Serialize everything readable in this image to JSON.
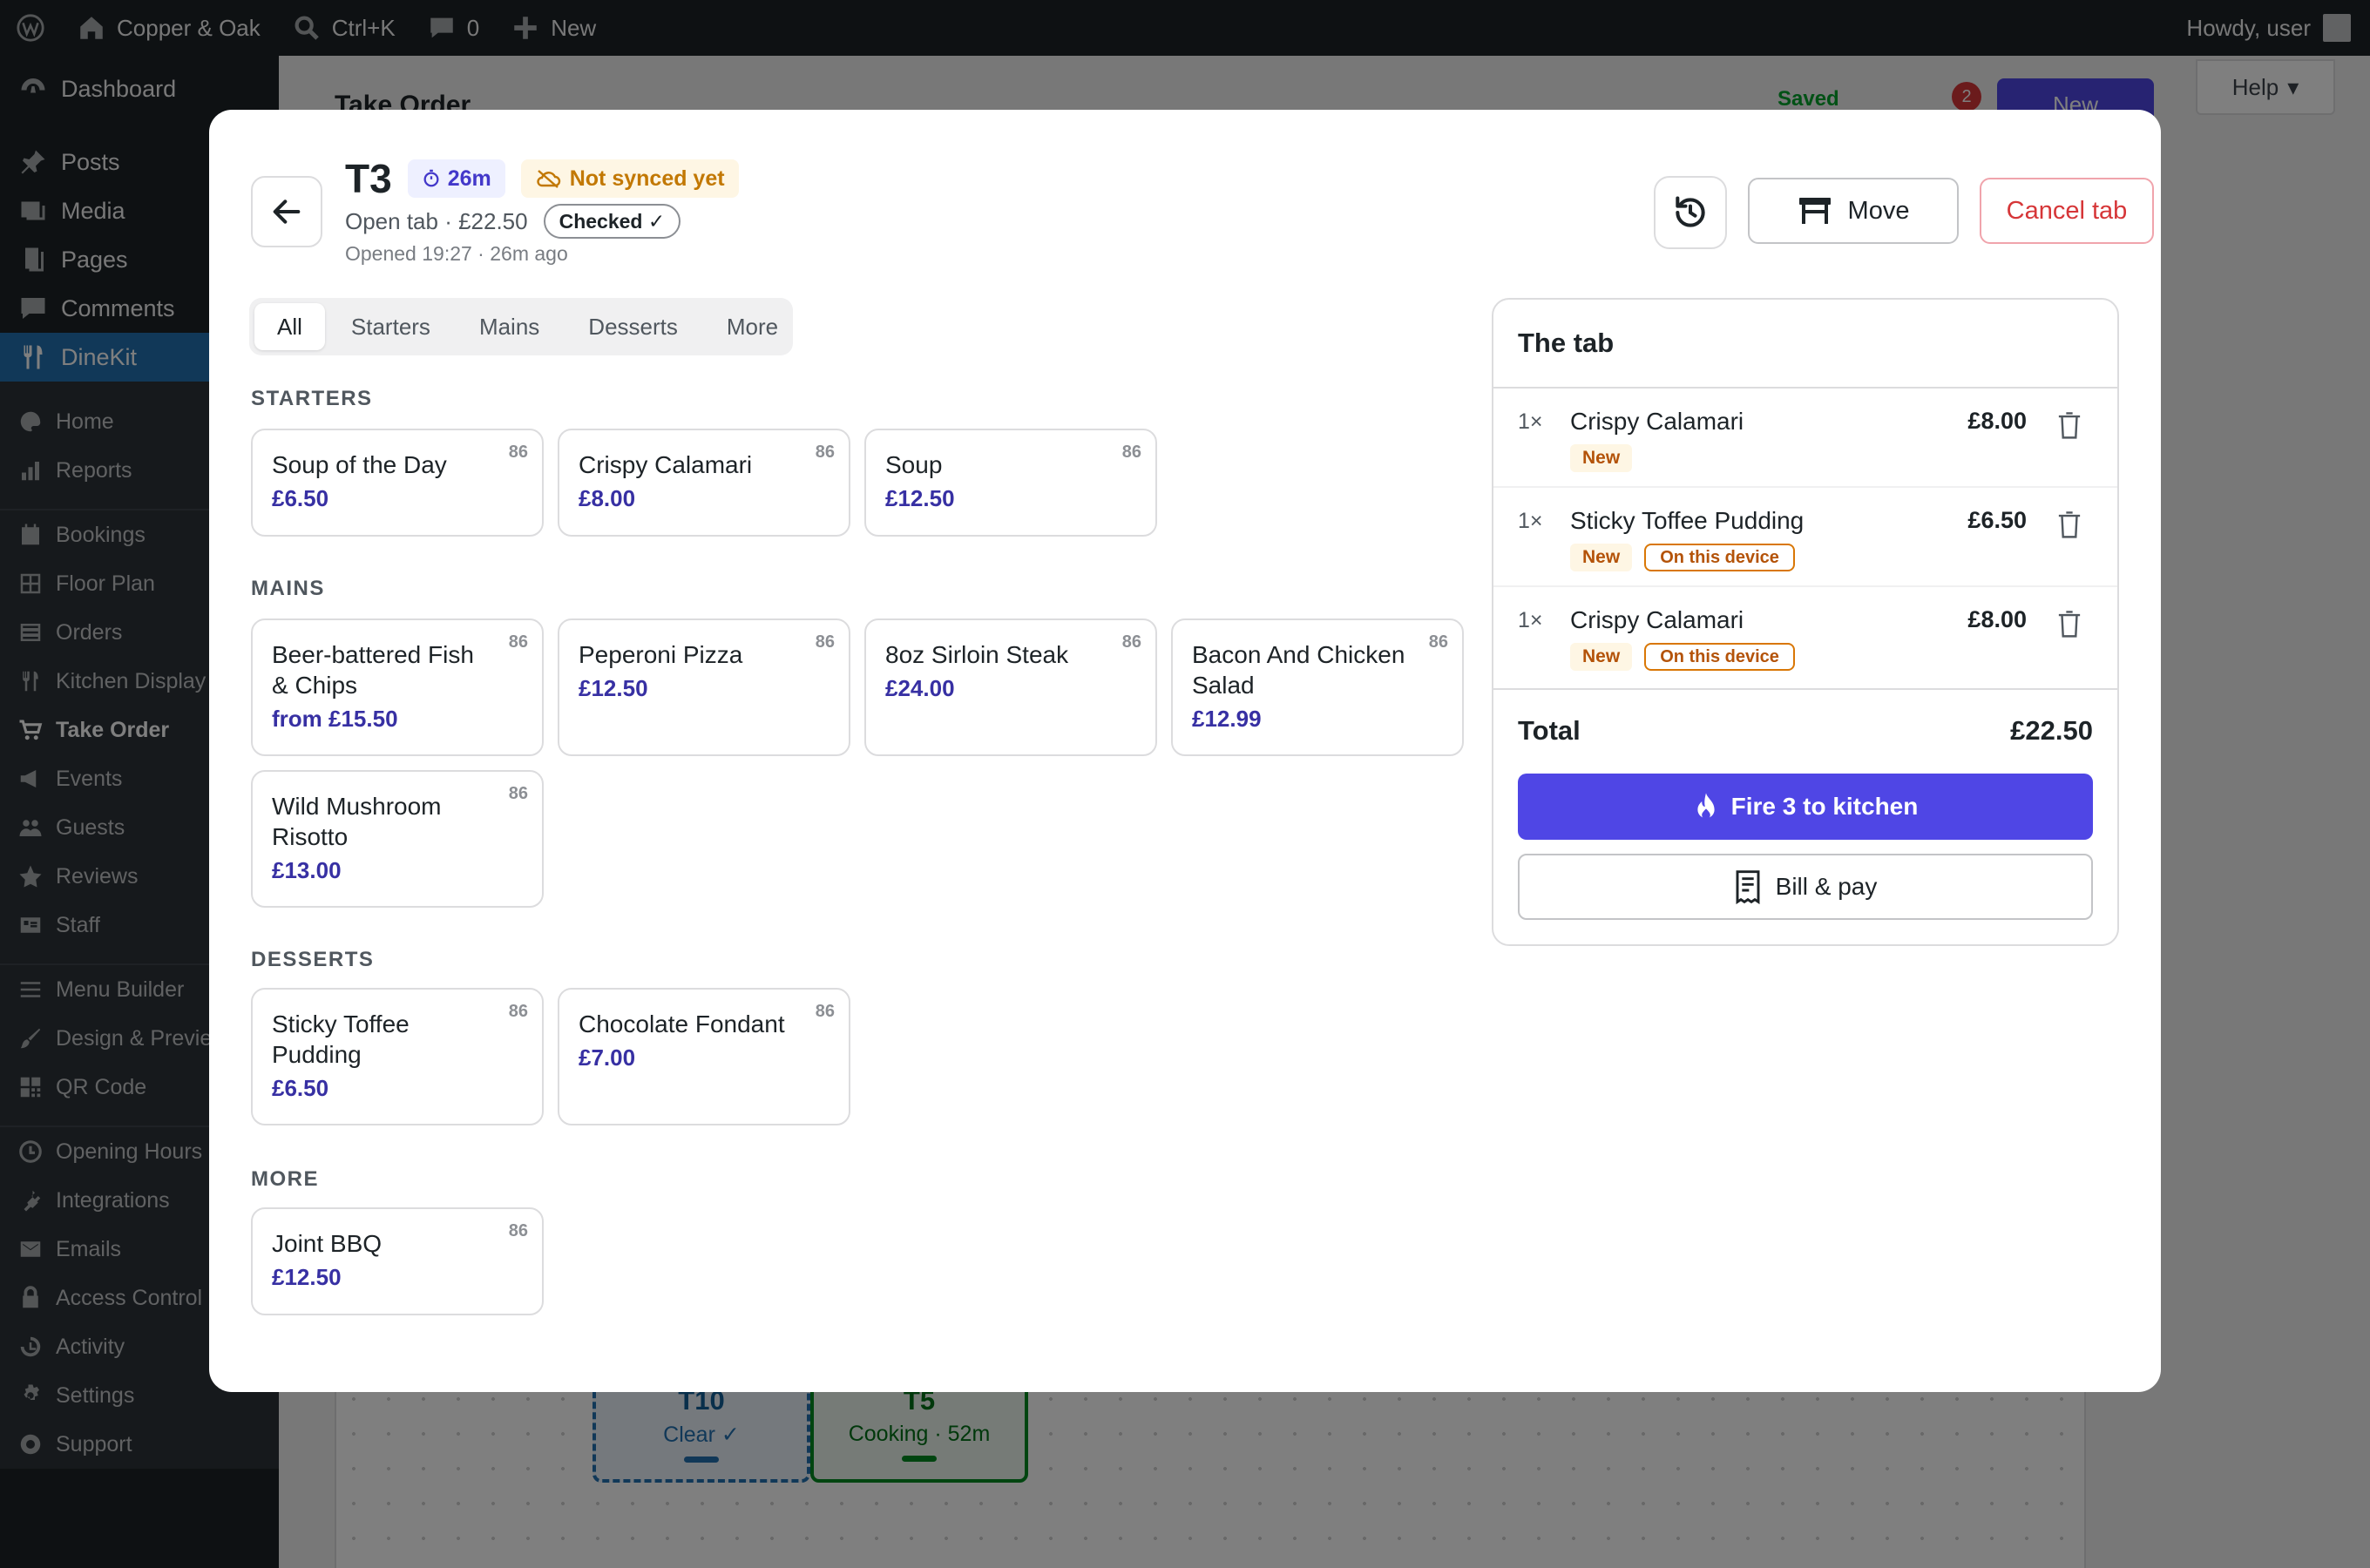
{
  "adminbar": {
    "site_name": "Copper & Oak",
    "search_shortcut": "Ctrl+K",
    "comments_count": "0",
    "new_label": "New",
    "howdy": "Howdy, user"
  },
  "sidebar": {
    "dashboard": "Dashboard",
    "posts": "Posts",
    "media": "Media",
    "pages": "Pages",
    "comments": "Comments",
    "dinekit": "DineKit",
    "sub": {
      "home": "Home",
      "reports": "Reports",
      "bookings": "Bookings",
      "floor_plan": "Floor Plan",
      "orders": "Orders",
      "kitchen_display": "Kitchen Display",
      "take_order": "Take Order",
      "events": "Events",
      "guests": "Guests",
      "reviews": "Reviews",
      "staff": "Staff",
      "menu_builder": "Menu Builder",
      "design_preview": "Design & Preview",
      "qr_code": "QR Code",
      "opening_hours": "Opening Hours",
      "integrations": "Integrations",
      "emails": "Emails",
      "access_control": "Access Control",
      "activity": "Activity",
      "settings": "Settings",
      "support": "Support"
    }
  },
  "background": {
    "page_title": "Take Order",
    "help_label": "Help",
    "saved_label": "Saved",
    "notif_count": "2",
    "new_label": "New",
    "tables": [
      {
        "name": "T10",
        "status": "Clear ✓"
      },
      {
        "name": "T5",
        "status": "Cooking · 52m"
      }
    ]
  },
  "modal": {
    "table": "T3",
    "elapsed": "26m",
    "sync_status": "Not synced yet",
    "tab_summary": "Open tab · £22.50",
    "checked_label": "Checked ✓",
    "opened": "Opened 19:27 · 26m ago",
    "move_label": "Move",
    "cancel_label": "Cancel tab",
    "filters": [
      "All",
      "Starters",
      "Mains",
      "Desserts",
      "More"
    ],
    "sections": {
      "starters": {
        "title": "STARTERS",
        "items": [
          {
            "name": "Soup of the Day",
            "price": "£6.50",
            "stock": "86"
          },
          {
            "name": "Crispy Calamari",
            "price": "£8.00",
            "stock": "86"
          },
          {
            "name": "Soup",
            "price": "£12.50",
            "stock": "86"
          }
        ]
      },
      "mains": {
        "title": "MAINS",
        "items": [
          {
            "name": "Beer-battered Fish & Chips",
            "price": "from £15.50",
            "stock": "86"
          },
          {
            "name": "Peperoni Pizza",
            "price": "£12.50",
            "stock": "86"
          },
          {
            "name": "8oz Sirloin Steak",
            "price": "£24.00",
            "stock": "86"
          },
          {
            "name": "Bacon And Chicken Salad",
            "price": "£12.99",
            "stock": "86"
          },
          {
            "name": "Wild Mushroom Risotto",
            "price": "£13.00",
            "stock": "86"
          }
        ]
      },
      "desserts": {
        "title": "DESSERTS",
        "items": [
          {
            "name": "Sticky Toffee Pudding",
            "price": "£6.50",
            "stock": "86"
          },
          {
            "name": "Chocolate Fondant",
            "price": "£7.00",
            "stock": "86"
          }
        ]
      },
      "more": {
        "title": "MORE",
        "items": [
          {
            "name": "Joint BBQ",
            "price": "£12.50",
            "stock": "86"
          }
        ]
      }
    },
    "tab_panel": {
      "title": "The tab",
      "lines": [
        {
          "qty": "1×",
          "name": "Crispy Calamari",
          "price": "£8.00",
          "badge_new": "New"
        },
        {
          "qty": "1×",
          "name": "Sticky Toffee Pudding",
          "price": "£6.50",
          "badge_new": "New",
          "badge_device": "On this device"
        },
        {
          "qty": "1×",
          "name": "Crispy Calamari",
          "price": "£8.00",
          "badge_new": "New",
          "badge_device": "On this device"
        }
      ],
      "total_label": "Total",
      "total_value": "£22.50",
      "fire_label": "Fire 3 to kitchen",
      "bill_label": "Bill & pay"
    }
  }
}
